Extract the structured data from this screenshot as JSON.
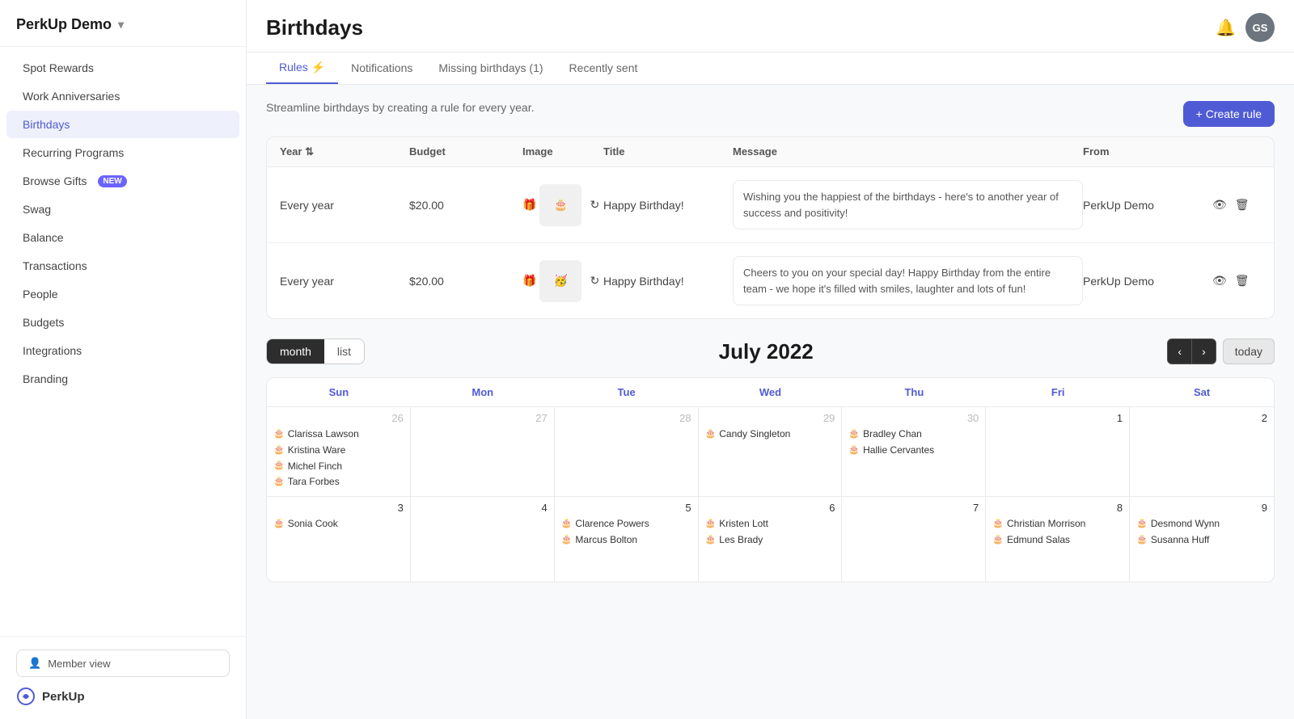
{
  "app": {
    "name": "PerkUp Demo",
    "user_initials": "GS"
  },
  "sidebar": {
    "items": [
      {
        "id": "spot-rewards",
        "label": "Spot Rewards",
        "active": false,
        "badge": null
      },
      {
        "id": "work-anniversaries",
        "label": "Work Anniversaries",
        "active": false,
        "badge": null
      },
      {
        "id": "birthdays",
        "label": "Birthdays",
        "active": true,
        "badge": null
      },
      {
        "id": "recurring-programs",
        "label": "Recurring Programs",
        "active": false,
        "badge": null
      },
      {
        "id": "browse-gifts",
        "label": "Browse Gifts",
        "active": false,
        "badge": "NEW"
      },
      {
        "id": "swag",
        "label": "Swag",
        "active": false,
        "badge": null
      },
      {
        "id": "balance",
        "label": "Balance",
        "active": false,
        "badge": null
      },
      {
        "id": "transactions",
        "label": "Transactions",
        "active": false,
        "badge": null
      },
      {
        "id": "people",
        "label": "People",
        "active": false,
        "badge": null
      },
      {
        "id": "budgets",
        "label": "Budgets",
        "active": false,
        "badge": null
      },
      {
        "id": "integrations",
        "label": "Integrations",
        "active": false,
        "badge": null
      },
      {
        "id": "branding",
        "label": "Branding",
        "active": false,
        "badge": null
      }
    ],
    "member_view_label": "Member view",
    "logo_label": "PerkUp"
  },
  "page": {
    "title": "Birthdays",
    "subtitle": "Streamline birthdays by creating a rule for every year."
  },
  "tabs": [
    {
      "id": "rules",
      "label": "Rules ⚡",
      "active": true
    },
    {
      "id": "notifications",
      "label": "Notifications",
      "active": false
    },
    {
      "id": "missing-birthdays",
      "label": "Missing birthdays (1)",
      "active": false
    },
    {
      "id": "recently-sent",
      "label": "Recently sent",
      "active": false
    }
  ],
  "toolbar": {
    "create_rule_label": "+ Create rule"
  },
  "rules_table": {
    "columns": [
      "Year",
      "Budget",
      "Image",
      "Title",
      "Message",
      "From",
      ""
    ],
    "rows": [
      {
        "year": "Every year",
        "budget": "$20.00",
        "image_emoji": "🎂",
        "title": "Happy Birthday!",
        "message": "Wishing you the happiest of the birthdays - here's to another year of success and positivity!",
        "from": "PerkUp Demo"
      },
      {
        "year": "Every year",
        "budget": "$20.00",
        "image_emoji": "🥳",
        "title": "Happy Birthday!",
        "message": "Cheers to you on your special day! Happy Birthday from the entire team - we hope it's filled with smiles, laughter and lots of fun!",
        "from": "PerkUp Demo"
      }
    ]
  },
  "calendar": {
    "view_month_label": "month",
    "view_list_label": "list",
    "active_view": "month",
    "month_year": "July 2022",
    "today_label": "today",
    "nav_prev": "‹",
    "nav_next": "›",
    "day_headers": [
      {
        "label": "Sun",
        "style": "blue"
      },
      {
        "label": "Mon",
        "style": "blue"
      },
      {
        "label": "Tue",
        "style": "blue"
      },
      {
        "label": "Wed",
        "style": "blue"
      },
      {
        "label": "Thu",
        "style": "blue"
      },
      {
        "label": "Fri",
        "style": "blue"
      },
      {
        "label": "Sat",
        "style": "blue"
      }
    ],
    "weeks": [
      {
        "days": [
          {
            "date": "26",
            "current": false,
            "birthdays": [
              "Clarissa Lawson",
              "Kristina Ware",
              "Michel Finch",
              "Tara Forbes"
            ]
          },
          {
            "date": "27",
            "current": false,
            "birthdays": []
          },
          {
            "date": "28",
            "current": false,
            "birthdays": []
          },
          {
            "date": "29",
            "current": false,
            "birthdays": [
              "Candy Singleton"
            ]
          },
          {
            "date": "30",
            "current": false,
            "birthdays": [
              "Bradley Chan",
              "Hallie Cervantes"
            ]
          },
          {
            "date": "1",
            "current": true,
            "birthdays": []
          },
          {
            "date": "2",
            "current": true,
            "birthdays": []
          }
        ]
      },
      {
        "days": [
          {
            "date": "3",
            "current": true,
            "birthdays": [
              "Sonia Cook"
            ]
          },
          {
            "date": "4",
            "current": true,
            "birthdays": []
          },
          {
            "date": "5",
            "current": true,
            "birthdays": [
              "Clarence Powers",
              "Marcus Bolton"
            ]
          },
          {
            "date": "6",
            "current": true,
            "birthdays": [
              "Kristen Lott",
              "Les Brady"
            ]
          },
          {
            "date": "7",
            "current": true,
            "birthdays": []
          },
          {
            "date": "8",
            "current": true,
            "birthdays": [
              "Christian Morrison",
              "Edmund Salas"
            ]
          },
          {
            "date": "9",
            "current": true,
            "birthdays": [
              "Desmond Wynn",
              "Susanna Huff"
            ]
          }
        ]
      }
    ]
  }
}
